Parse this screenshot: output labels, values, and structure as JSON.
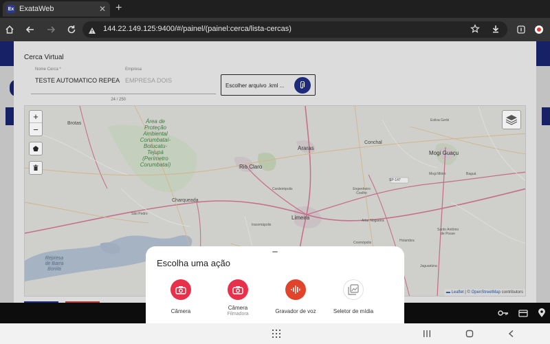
{
  "browser": {
    "tab_favicon": "Ex",
    "tab_title": "ExataWeb",
    "tab_close": "✕",
    "new_tab": "+",
    "url": "144.22.149.125:9400/#/painel/(painel:cerca/lista-cercas)"
  },
  "modal": {
    "title": "Cerca Virtual",
    "name_field": {
      "label": "Nome Cerca *",
      "value": "TESTE AUTOMATICO REPEA",
      "counter": "24 / 250"
    },
    "company_field": {
      "label": "Empresa",
      "value": "EMPRESA DOIS"
    },
    "upload": {
      "label": "Escolher arquivo .kml ..."
    }
  },
  "map": {
    "zoom_in": "+",
    "zoom_out": "−",
    "labels": {
      "brotas": "Brotas",
      "area1": "Área de",
      "area2": "Proteção",
      "area3": "Ambiental",
      "area4": "Corumbataí-",
      "area5": "Botucatu-",
      "area6": "Tejupá",
      "area7": "(Perímetro",
      "area8": "Corumbataí)",
      "araras": "Araras",
      "rio_claro": "Rio Claro",
      "conchal": "Conchal",
      "estiva_gerbi": "Estiva Gerbi",
      "mogi_guacu": "Mogi Guaçu",
      "mogi_mirim": "Mogi Mirim",
      "charqueada": "Charqueada",
      "cordeiropolis": "Cordeirópolis",
      "engenheiro_coelho": "Engenheiro Coelho",
      "artur_nogueira": "Artur Nogueira",
      "limeira": "Limeira",
      "sao_pedro": "São Pedro",
      "iracemapolis": "Iracemápolis",
      "cosmopolis": "Cosmópolis",
      "holambra": "Holambra",
      "santo_antonio1": "Santo Antônio",
      "santo_antonio2": "de Posse",
      "jaguariuna": "Jaguariúna",
      "represa1": "Represa",
      "represa2": "de Barra",
      "represa3": "Bonita",
      "sp147": "SP-147",
      "bagua": "Baguá"
    },
    "attribution": {
      "leaflet": "Leaflet",
      "sep": "|",
      "copy": "©",
      "osm": "OpenStreetMap",
      "contributors": "contributors"
    }
  },
  "sheet": {
    "title": "Escolha uma ação",
    "actions": [
      {
        "label": "Câmera",
        "sub": ""
      },
      {
        "label": "Câmera",
        "sub": "Filmadora"
      },
      {
        "label": "Gravador de voz",
        "sub": ""
      },
      {
        "label": "Seletor de mídia",
        "sub": ""
      }
    ]
  },
  "colors": {
    "brand_navy": "#162166",
    "upload_button": "#1d2b7a",
    "camera_red": "#e8304a",
    "voice_red": "#e0452c"
  }
}
